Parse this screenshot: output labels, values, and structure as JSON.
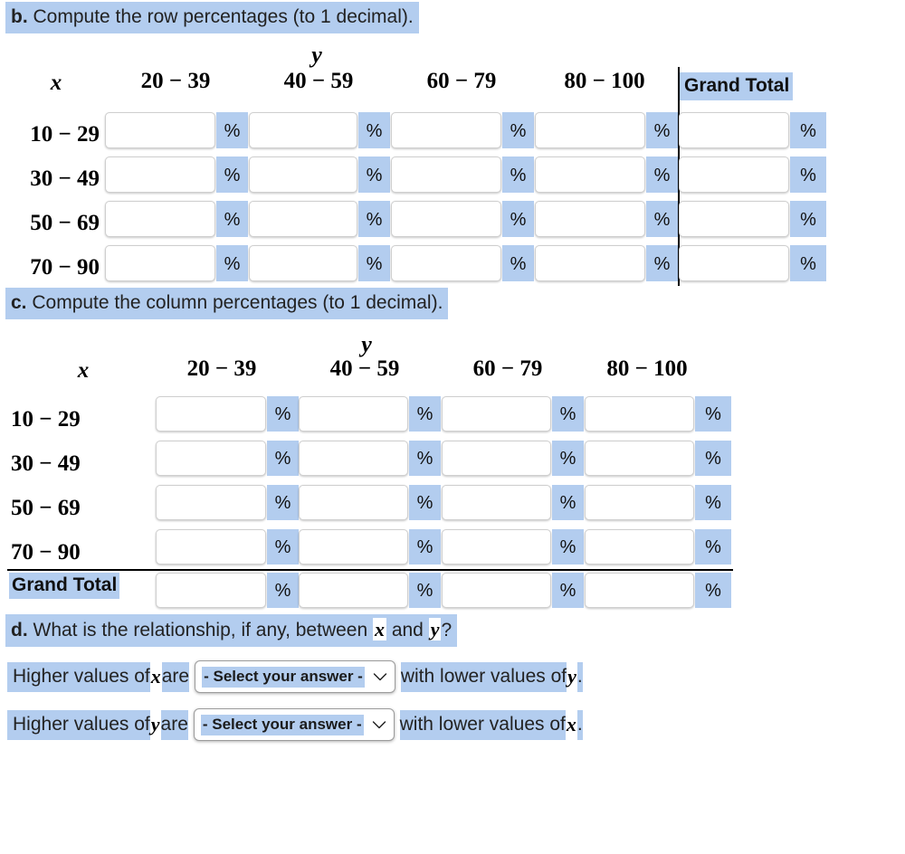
{
  "colors": {
    "highlight": "#b3cdef",
    "field_border": "#cfcfcf",
    "rule": "#000000"
  },
  "section_b": {
    "prompt_marker": "b.",
    "prompt_text": " Compute the row percentages (to 1 decimal).",
    "table": {
      "corner_label": "x",
      "y_label": "y",
      "column_headers": [
        "20 − 39",
        "40 − 59",
        "60 − 79",
        "80 − 100"
      ],
      "grand_total_header": "Grand Total",
      "row_labels": [
        "10 − 29",
        "30 − 49",
        "50 − 69",
        "70 − 90"
      ],
      "percent_symbol": "%",
      "cell_values": [
        [
          "",
          "",
          "",
          "",
          ""
        ],
        [
          "",
          "",
          "",
          "",
          ""
        ],
        [
          "",
          "",
          "",
          "",
          ""
        ],
        [
          "",
          "",
          "",
          "",
          ""
        ]
      ]
    }
  },
  "section_c": {
    "prompt_marker": "c.",
    "prompt_text": " Compute the column percentages (to 1 decimal).",
    "table": {
      "corner_label": "x",
      "y_label": "y",
      "column_headers": [
        "20 − 39",
        "40 − 59",
        "60 − 79",
        "80 − 100"
      ],
      "row_labels": [
        "10 − 29",
        "30 − 49",
        "50 − 69",
        "70 − 90"
      ],
      "grand_total_label": "Grand Total",
      "percent_symbol": "%",
      "cell_values": [
        [
          "",
          "",
          "",
          ""
        ],
        [
          "",
          "",
          "",
          ""
        ],
        [
          "",
          "",
          "",
          ""
        ],
        [
          "",
          "",
          "",
          ""
        ],
        [
          "",
          "",
          "",
          ""
        ]
      ]
    }
  },
  "section_d": {
    "prompt_marker": "d.",
    "prompt_text": " What is the relationship, if any, between ",
    "prompt_var1": "x",
    "prompt_mid": " and ",
    "prompt_var2": "y",
    "prompt_end": "?",
    "statements": [
      {
        "lead": "Higher values of ",
        "var1": "x",
        "mid": " are ",
        "select_value": "- Select your answer -",
        "tail": "with lower values of ",
        "var2": "y",
        "period": "."
      },
      {
        "lead": "Higher values of ",
        "var1": "y",
        "mid": " are ",
        "select_value": "- Select your answer -",
        "tail": "with lower values of ",
        "var2": "x",
        "period": "."
      }
    ]
  }
}
